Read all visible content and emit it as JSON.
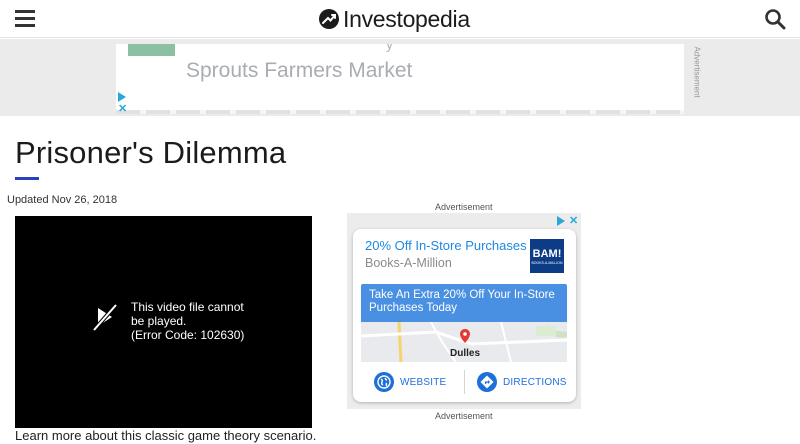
{
  "header": {
    "logo_text": "Investopedia",
    "menu_icon": "hamburger-menu-icon",
    "search_icon": "search-icon"
  },
  "top_ad": {
    "advertiser": "Sprouts Farmers Market",
    "vertical_label": "Advertisement",
    "close_symbol": "✕"
  },
  "article": {
    "title": "Prisoner's Dilemma",
    "updated": "Updated Nov 26, 2018",
    "accent_color": "#2c40c2"
  },
  "video": {
    "error_line1": "This video file cannot",
    "error_line2": "be played.",
    "error_line3": "(Error Code: 102630)",
    "caption": "Learn more about this classic game theory scenario."
  },
  "side_ad": {
    "label_top": "Advertisement",
    "label_bottom": "Advertisement",
    "headline": "20% Off In-Store Purchases",
    "advertiser": "Books-A-Million",
    "logo_text": "BAM!",
    "logo_subtext": "BOOKS-A-MILLION",
    "offer": "Take An Extra 20% Off Your In-Store Purchases Today",
    "map_location": "Dulles",
    "website_label": "WEBSITE",
    "directions_label": "DIRECTIONS",
    "close_symbol": "✕",
    "button_color": "#1e6fd9",
    "offer_color": "#4a90e2"
  }
}
